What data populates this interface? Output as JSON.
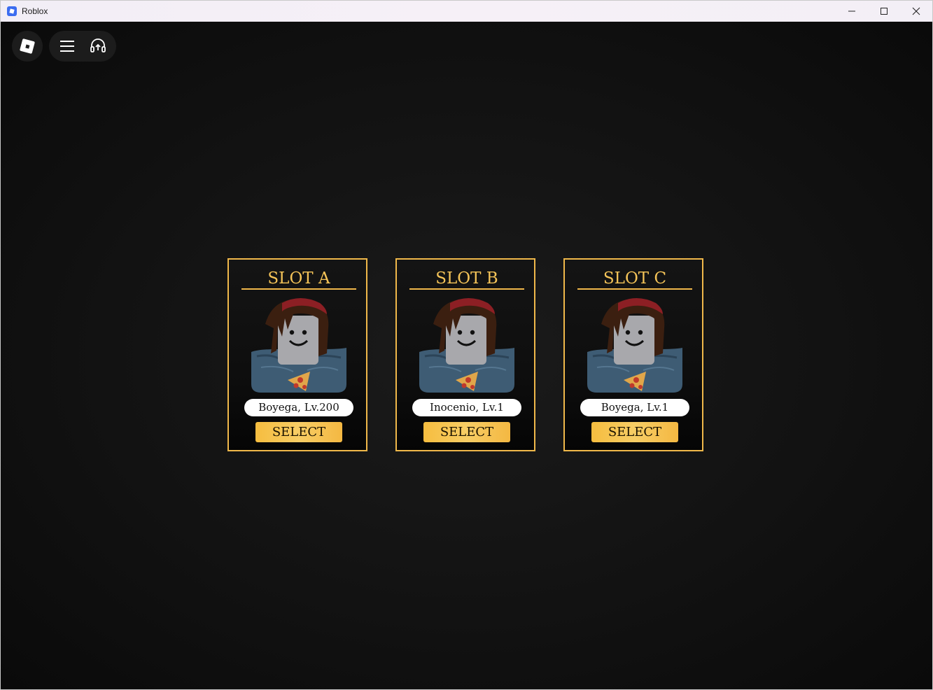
{
  "window": {
    "title": "Roblox",
    "minimize_glyph": "—",
    "maximize_glyph": "☐",
    "close_glyph": "✕"
  },
  "toolbar": {
    "roblox_icon": "roblox-logo-icon",
    "menu_icon": "hamburger-menu-icon",
    "support_icon": "headset-support-icon"
  },
  "slots": [
    {
      "title": "SLOT A",
      "character": "Boyega, Lv.200",
      "button": "SELECT"
    },
    {
      "title": "SLOT B",
      "character": "Inocenio, Lv.1",
      "button": "SELECT"
    },
    {
      "title": "SLOT C",
      "character": "Boyega, Lv.1",
      "button": "SELECT"
    }
  ],
  "colors": {
    "accent": "#f0b84a",
    "title_gold": "#f5c458",
    "button_gold": "#f6bd3f",
    "background": "#0b0b0b"
  }
}
